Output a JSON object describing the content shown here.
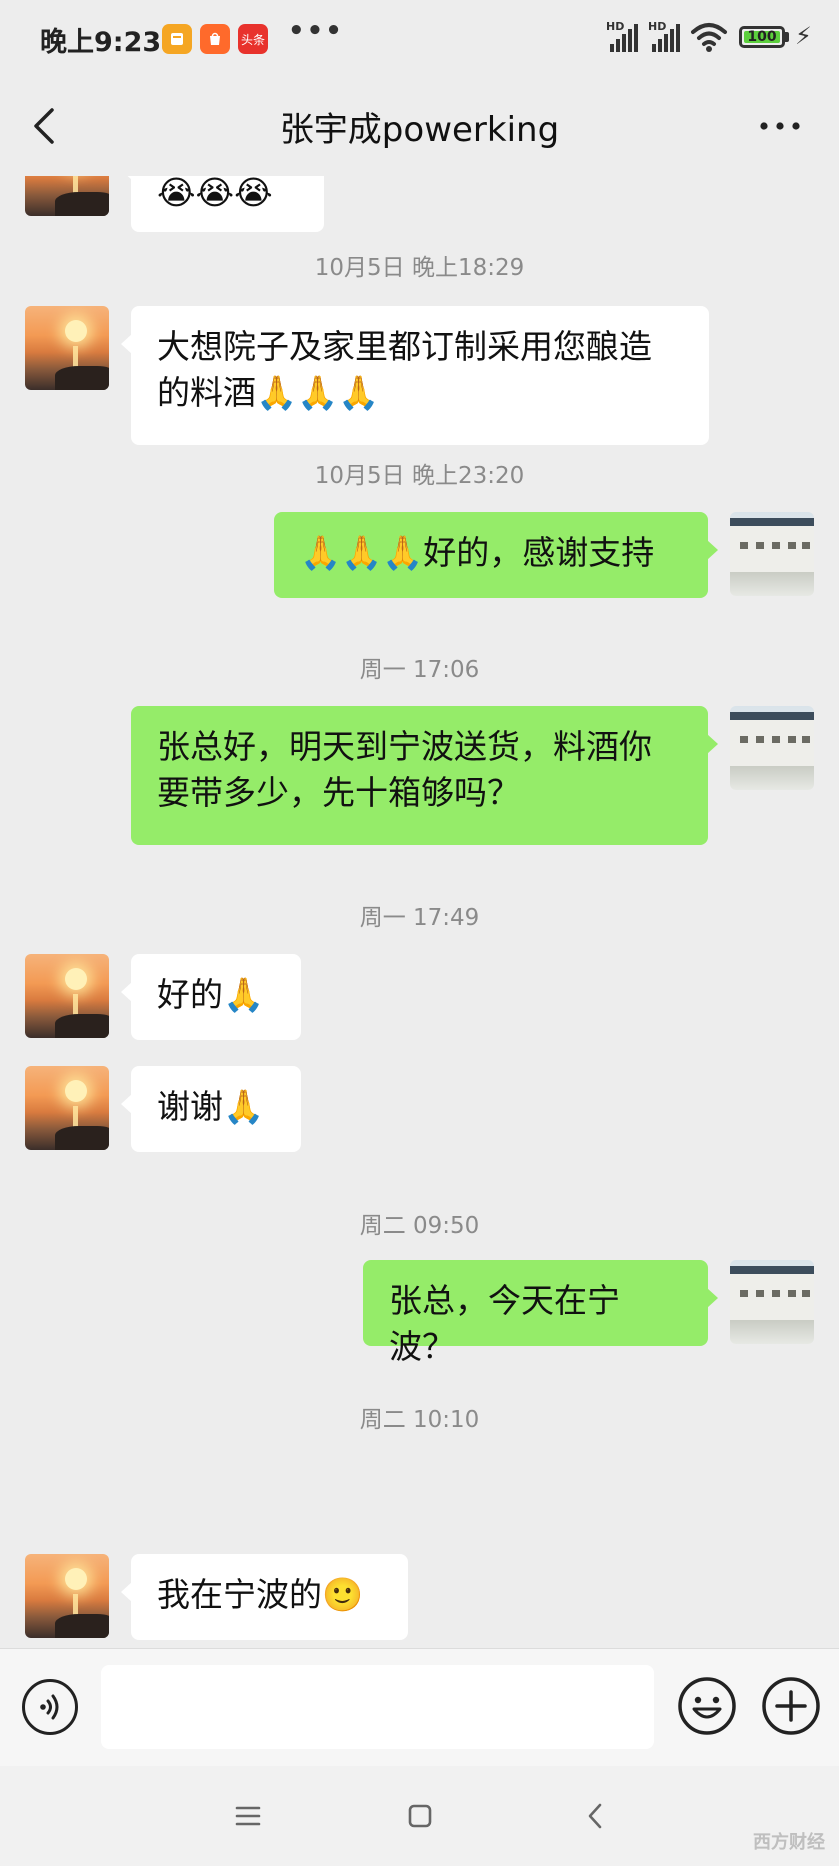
{
  "status_bar": {
    "time": "晚上9:23",
    "app_badge": "头条",
    "more": "•••",
    "signal_1_label": "HD",
    "signal_2_label": "HD",
    "battery": "100"
  },
  "header": {
    "title": "张宇成powerking"
  },
  "messages": [
    {
      "type": "left",
      "text": "😭😭😭"
    },
    {
      "type": "time",
      "text": "10月5日 晚上18:29"
    },
    {
      "type": "left",
      "text": "大想院子及家里都订制采用您酿造的料酒🙏🙏🙏"
    },
    {
      "type": "time",
      "text": "10月5日 晚上23:20"
    },
    {
      "type": "right",
      "text": "🙏🙏🙏好的，感谢支持"
    },
    {
      "type": "time",
      "text": "周一 17:06"
    },
    {
      "type": "right",
      "text": "张总好，明天到宁波送货，料酒你要带多少，先十箱够吗？"
    },
    {
      "type": "time",
      "text": "周一 17:49"
    },
    {
      "type": "left",
      "text": "好的🙏"
    },
    {
      "type": "left",
      "text": "谢谢🙏"
    },
    {
      "type": "time",
      "text": "周二 09:50"
    },
    {
      "type": "right",
      "text": "张总，今天在宁波？"
    },
    {
      "type": "time",
      "text": "周二 10:10"
    },
    {
      "type": "left",
      "text": "我在宁波的🙂"
    }
  ],
  "input": {
    "value": "",
    "placeholder": ""
  },
  "icons": {
    "back": "chevron-left-icon",
    "more": "ellipsis-icon",
    "voice": "voice-icon",
    "emoji": "emoji-icon",
    "plus": "plus-icon"
  },
  "watermark": "西方财经",
  "colors": {
    "background": "#ededed",
    "bubble_self": "#95ec69",
    "bubble_other": "#ffffff",
    "timestamp": "#8a8a8a"
  }
}
